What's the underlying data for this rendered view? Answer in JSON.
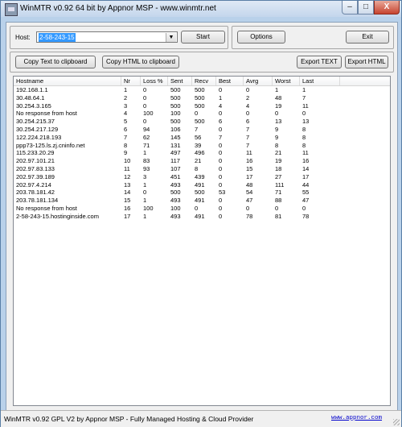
{
  "window": {
    "title": "WinMTR v0.92 64 bit by Appnor MSP - www.winmtr.net"
  },
  "caption_buttons": {
    "minimize": "–",
    "maximize": "□",
    "close": "X"
  },
  "host": {
    "label": "Host:",
    "value": "2-58-243-15"
  },
  "buttons": {
    "start": "Start",
    "options": "Options",
    "exit": "Exit",
    "copy_text": "Copy Text to clipboard",
    "copy_html": "Copy HTML to clipboard",
    "export_text": "Export TEXT",
    "export_html": "Export HTML"
  },
  "table": {
    "columns": [
      "Hostname",
      "Nr",
      "Loss %",
      "Sent",
      "Recv",
      "Best",
      "Avrg",
      "Worst",
      "Last"
    ],
    "rows": [
      [
        "192.168.1.1",
        "1",
        "0",
        "500",
        "500",
        "0",
        "0",
        "1",
        "1"
      ],
      [
        "30.48.64.1",
        "2",
        "0",
        "500",
        "500",
        "1",
        "2",
        "48",
        "7"
      ],
      [
        "30.254.3.165",
        "3",
        "0",
        "500",
        "500",
        "4",
        "4",
        "19",
        "11"
      ],
      [
        "No response from host",
        "4",
        "100",
        "100",
        "0",
        "0",
        "0",
        "0",
        "0"
      ],
      [
        "30.254.215.37",
        "5",
        "0",
        "500",
        "500",
        "6",
        "6",
        "13",
        "13"
      ],
      [
        "30.254.217.129",
        "6",
        "94",
        "106",
        "7",
        "0",
        "7",
        "9",
        "8"
      ],
      [
        "122.224.218.193",
        "7",
        "62",
        "145",
        "56",
        "7",
        "7",
        "9",
        "8"
      ],
      [
        "ppp73-125.ls.zj.cninfo.net",
        "8",
        "71",
        "131",
        "39",
        "0",
        "7",
        "8",
        "8"
      ],
      [
        "115.233.20.29",
        "9",
        "1",
        "497",
        "496",
        "0",
        "11",
        "21",
        "11"
      ],
      [
        "202.97.101.21",
        "10",
        "83",
        "117",
        "21",
        "0",
        "16",
        "19",
        "16"
      ],
      [
        "202.97.83.133",
        "11",
        "93",
        "107",
        "8",
        "0",
        "15",
        "18",
        "14"
      ],
      [
        "202.97.39.189",
        "12",
        "3",
        "451",
        "439",
        "0",
        "17",
        "27",
        "17"
      ],
      [
        "202.97.4.214",
        "13",
        "1",
        "493",
        "491",
        "0",
        "48",
        "111",
        "44"
      ],
      [
        "203.78.181.42",
        "14",
        "0",
        "500",
        "500",
        "53",
        "54",
        "71",
        "55"
      ],
      [
        "203.78.181.134",
        "15",
        "1",
        "493",
        "491",
        "0",
        "47",
        "88",
        "47"
      ],
      [
        "No response from host",
        "16",
        "100",
        "100",
        "0",
        "0",
        "0",
        "0",
        "0"
      ],
      [
        "2-58-243-15.hostinginside.com",
        "17",
        "1",
        "493",
        "491",
        "0",
        "78",
        "81",
        "78"
      ]
    ]
  },
  "statusbar": {
    "text": "WinMTR v0.92 GPL V2 by Appnor MSP - Fully Managed Hosting & Cloud Provider",
    "link": "www.appnor.com"
  }
}
